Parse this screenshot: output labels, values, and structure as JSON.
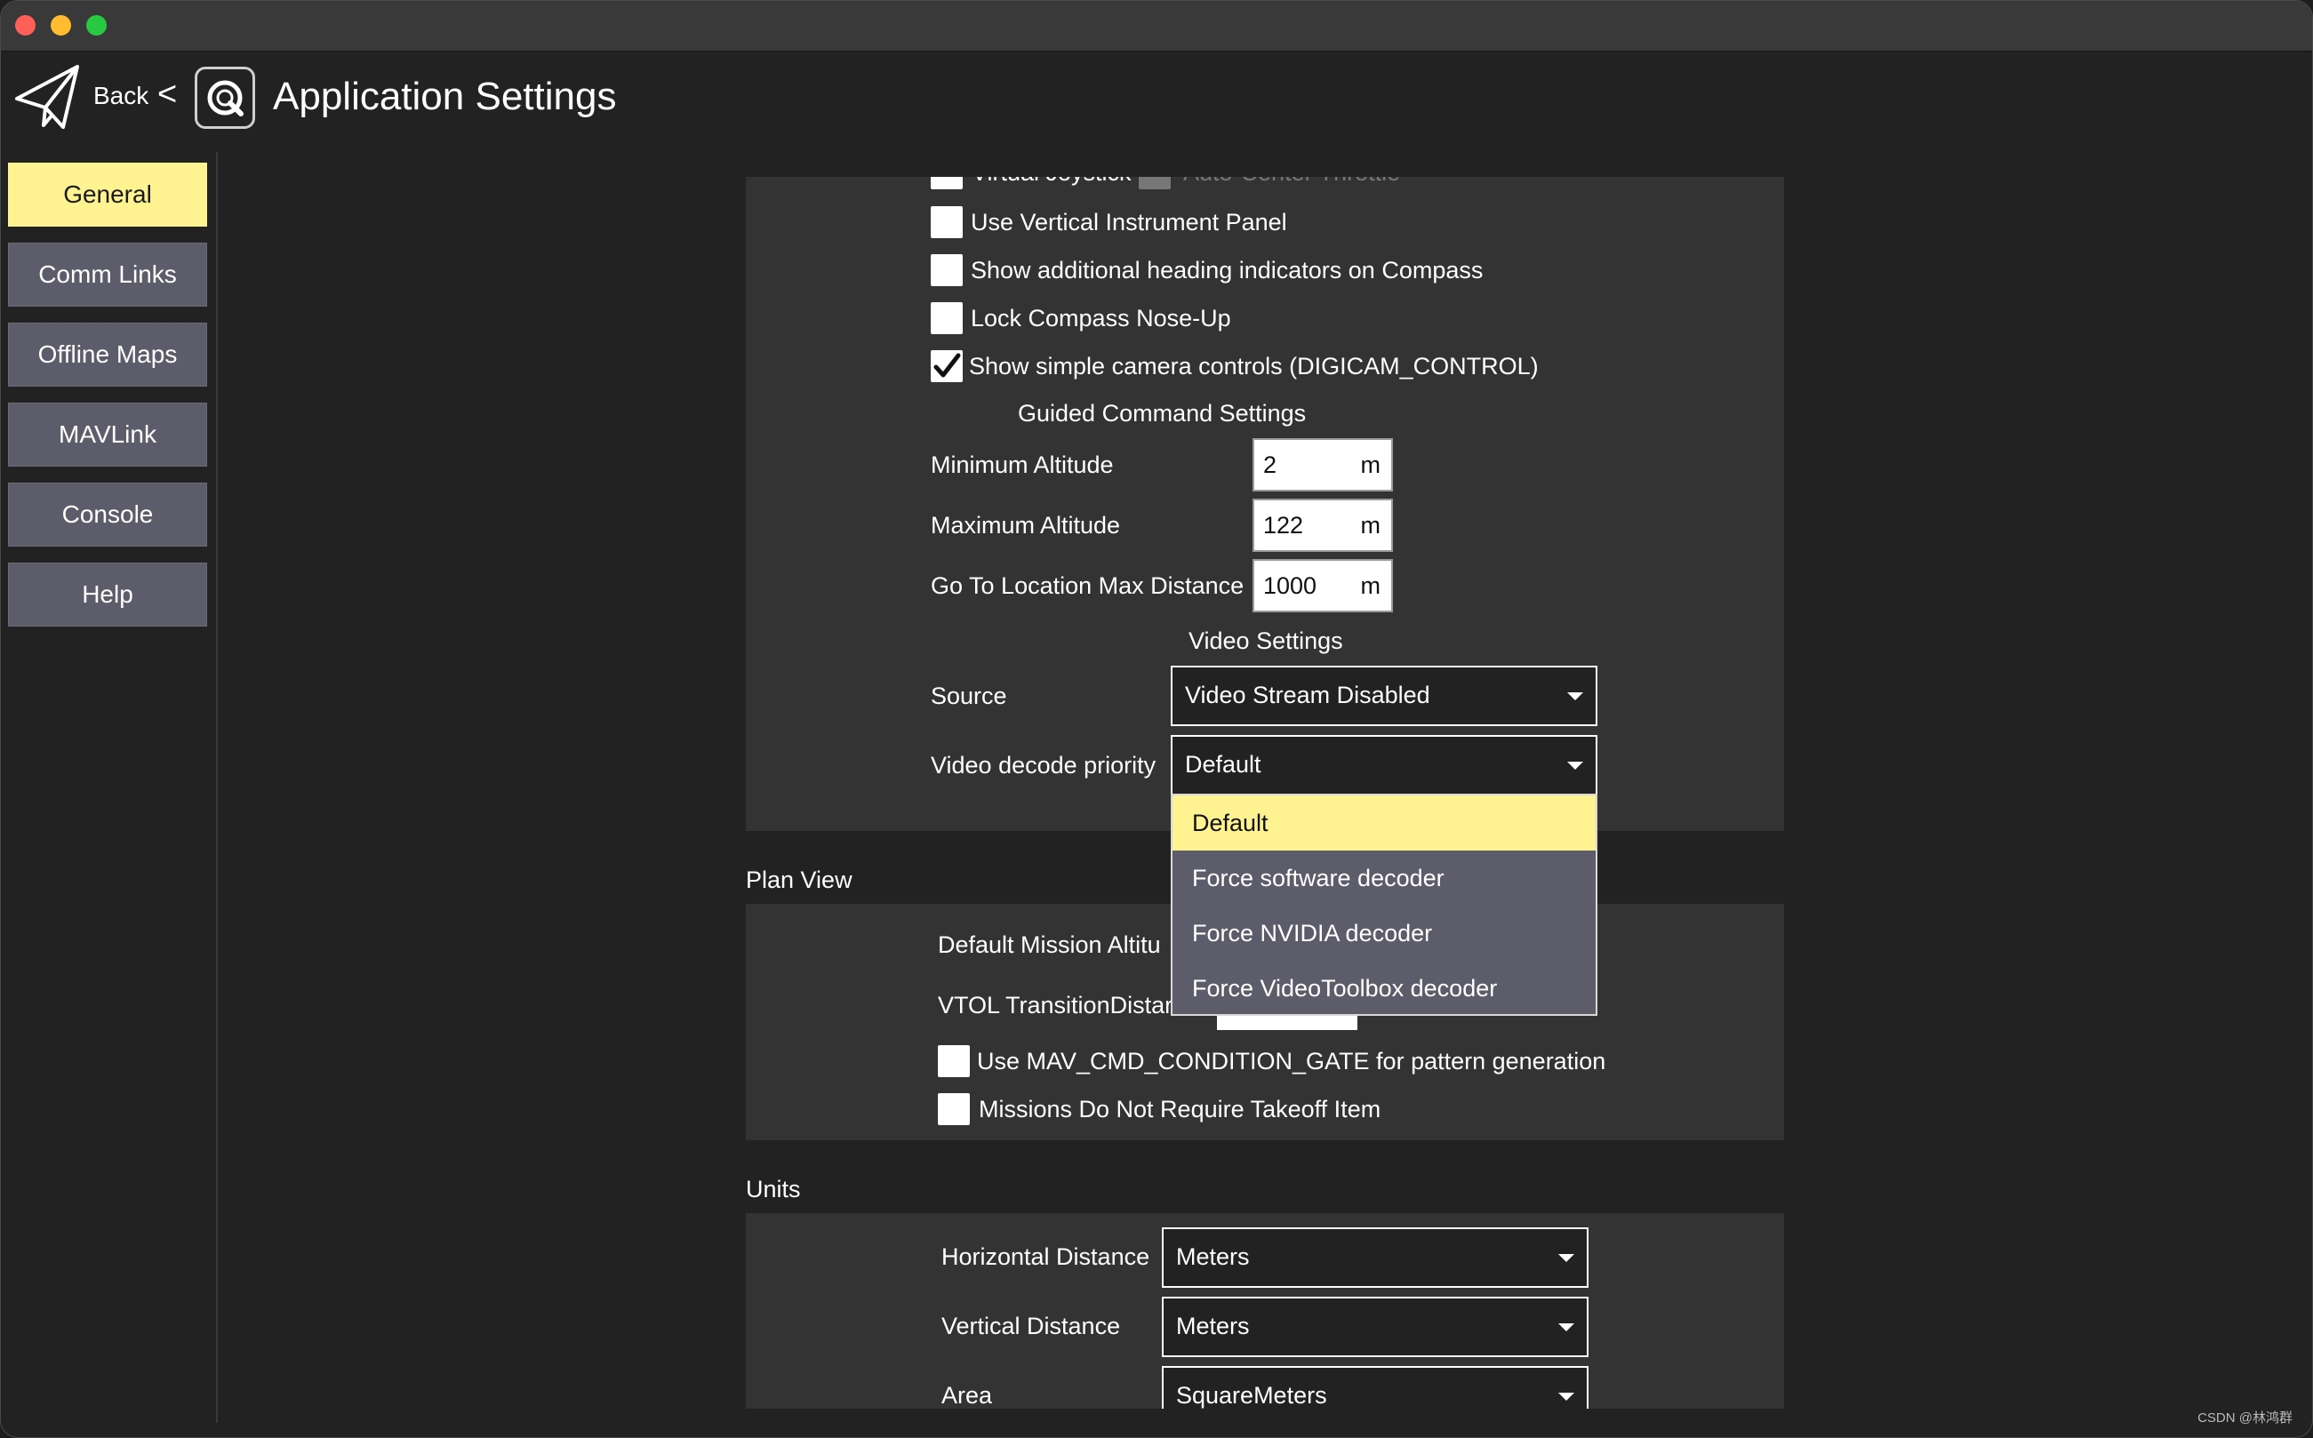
{
  "window": {
    "title_icon": "qgc-logo-icon",
    "back_label": "Back",
    "chevron": "<",
    "page_title": "Application Settings"
  },
  "sidebar": {
    "items": [
      {
        "label": "General",
        "active": true
      },
      {
        "label": "Comm Links",
        "active": false
      },
      {
        "label": "Offline Maps",
        "active": false
      },
      {
        "label": "MAVLink",
        "active": false
      },
      {
        "label": "Console",
        "active": false
      },
      {
        "label": "Help",
        "active": false
      }
    ]
  },
  "fly_view": {
    "partial_virtual_joystick": "Virtual Joystick",
    "partial_auto_center": "Auto-Center Throttle",
    "checkboxes": [
      {
        "label": "Use Vertical Instrument Panel",
        "checked": false
      },
      {
        "label": "Show additional heading indicators on Compass",
        "checked": false
      },
      {
        "label": "Lock Compass Nose-Up",
        "checked": false
      },
      {
        "label": "Show simple camera controls (DIGICAM_CONTROL)",
        "checked": true
      }
    ],
    "guided_heading": "Guided Command Settings",
    "guided": [
      {
        "label": "Minimum Altitude",
        "value": "2",
        "unit": "m"
      },
      {
        "label": "Maximum Altitude",
        "value": "122",
        "unit": "m"
      },
      {
        "label": "Go To Location Max Distance",
        "value": "1000",
        "unit": "m"
      }
    ],
    "video_heading": "Video Settings",
    "source_label": "Source",
    "source_value": "Video Stream Disabled",
    "decode_label": "Video decode priority",
    "decode_value": "Default",
    "decode_options": [
      "Default",
      "Force software decoder",
      "Force NVIDIA decoder",
      "Force VideoToolbox decoder"
    ]
  },
  "plan_view": {
    "title": "Plan View",
    "default_mission_altitude_partial": "Default Mission Altitu",
    "vtol_transition_partial": "VTOL TransitionDistar",
    "checkboxes": [
      {
        "label": "Use MAV_CMD_CONDITION_GATE for pattern generation",
        "checked": false
      },
      {
        "label": "Missions Do Not Require Takeoff Item",
        "checked": false
      }
    ]
  },
  "units": {
    "title": "Units",
    "rows": [
      {
        "label": "Horizontal Distance",
        "value": "Meters"
      },
      {
        "label": "Vertical Distance",
        "value": "Meters"
      },
      {
        "label": "Area",
        "value": "SquareMeters"
      }
    ]
  },
  "watermark": "CSDN @林鸿群",
  "colors": {
    "accent_yellow": "#fff291",
    "sidebar_button": "#5d5c6b",
    "panel": "#333333",
    "background": "#222222"
  }
}
